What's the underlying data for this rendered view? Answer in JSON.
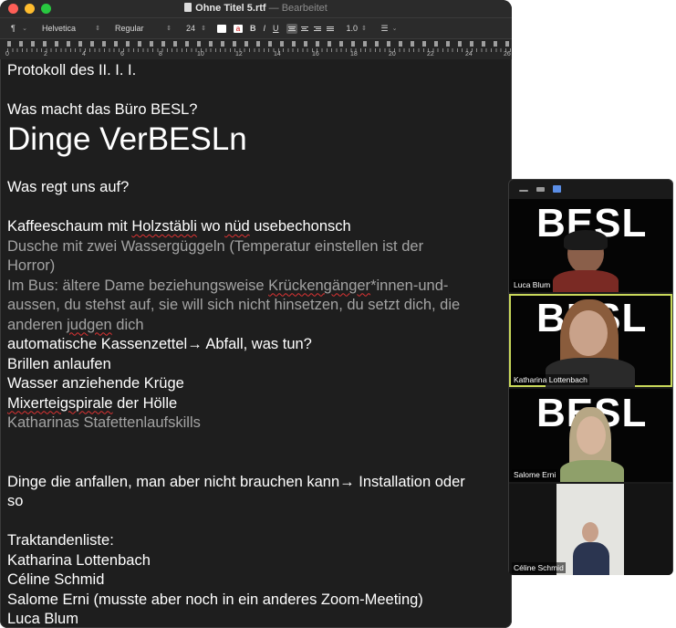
{
  "window": {
    "title": "Ohne Titel 5.rtf",
    "status": "— Bearbeitet"
  },
  "toolbar": {
    "paragraph_style": "¶",
    "font_family": "Helvetica",
    "font_style": "Regular",
    "font_size": "24",
    "bold": "B",
    "italic": "I",
    "underline": "U",
    "line_spacing": "1.0",
    "list_icon": "list-icon"
  },
  "ruler": {
    "marks": [
      "0",
      "2",
      "4",
      "6",
      "8",
      "10",
      "12",
      "14",
      "16",
      "18",
      "20",
      "22",
      "24",
      "26"
    ]
  },
  "document": {
    "lines": [
      {
        "text": "Protokoll des II. I. I.",
        "style": "normal"
      },
      {
        "text": "",
        "style": "normal"
      },
      {
        "text": "Was macht das Büro BESL?",
        "style": "normal"
      },
      {
        "text": "Dinge VerBESLn",
        "style": "big"
      },
      {
        "text": "",
        "style": "normal"
      },
      {
        "text": "Was regt uns auf?",
        "style": "normal"
      },
      {
        "text": "",
        "style": "normal"
      },
      {
        "text": "Kaffeeschaum mit Holzstäbli wo nüd usebechonsch",
        "style": "normal"
      },
      {
        "text": "Dusche mit zwei Wassergüggeln (Temperatur einstellen ist der",
        "style": "gray"
      },
      {
        "text": "Horror)",
        "style": "gray"
      },
      {
        "text": "Im Bus: ältere Dame beziehungsweise Krückengänger*innen-und-",
        "style": "gray"
      },
      {
        "text": "aussen, du stehst auf, sie will sich nicht hinsetzen, du setzt dich, die",
        "style": "gray"
      },
      {
        "text": "anderen judgen dich",
        "style": "gray"
      },
      {
        "text": "automatische Kassenzettel→ Abfall, was tun?",
        "style": "normal"
      },
      {
        "text": "Brillen anlaufen",
        "style": "normal"
      },
      {
        "text": "Wasser anziehende Krüge",
        "style": "normal"
      },
      {
        "text": "Mixerteigspirale der Hölle",
        "style": "normal"
      },
      {
        "text": "Katharinas Stafettenlaufskills",
        "style": "gray"
      },
      {
        "text": "",
        "style": "normal"
      },
      {
        "text": "",
        "style": "normal"
      },
      {
        "text": "Dinge die anfallen, man aber nicht brauchen kann→ Installation oder",
        "style": "normal"
      },
      {
        "text": "so",
        "style": "normal"
      },
      {
        "text": "",
        "style": "normal"
      },
      {
        "text": "Traktandenliste:",
        "style": "normal"
      },
      {
        "text": "Katharina Lottenbach",
        "style": "normal"
      },
      {
        "text": "Céline Schmid",
        "style": "normal"
      },
      {
        "text": "Salome Erni (musste aber noch in ein anderes Zoom-Meeting)",
        "style": "normal"
      },
      {
        "text": "Luca Blum",
        "style": "normal"
      }
    ]
  },
  "zoom": {
    "background_text": "BESL",
    "participants": [
      {
        "name": "Luca Blum",
        "active": false
      },
      {
        "name": "Katharina Lottenbach",
        "active": true
      },
      {
        "name": "Salome Erni",
        "active": false
      },
      {
        "name": "Céline Schmid",
        "active": false
      }
    ],
    "active_speaker_color": "#c9d85a"
  }
}
